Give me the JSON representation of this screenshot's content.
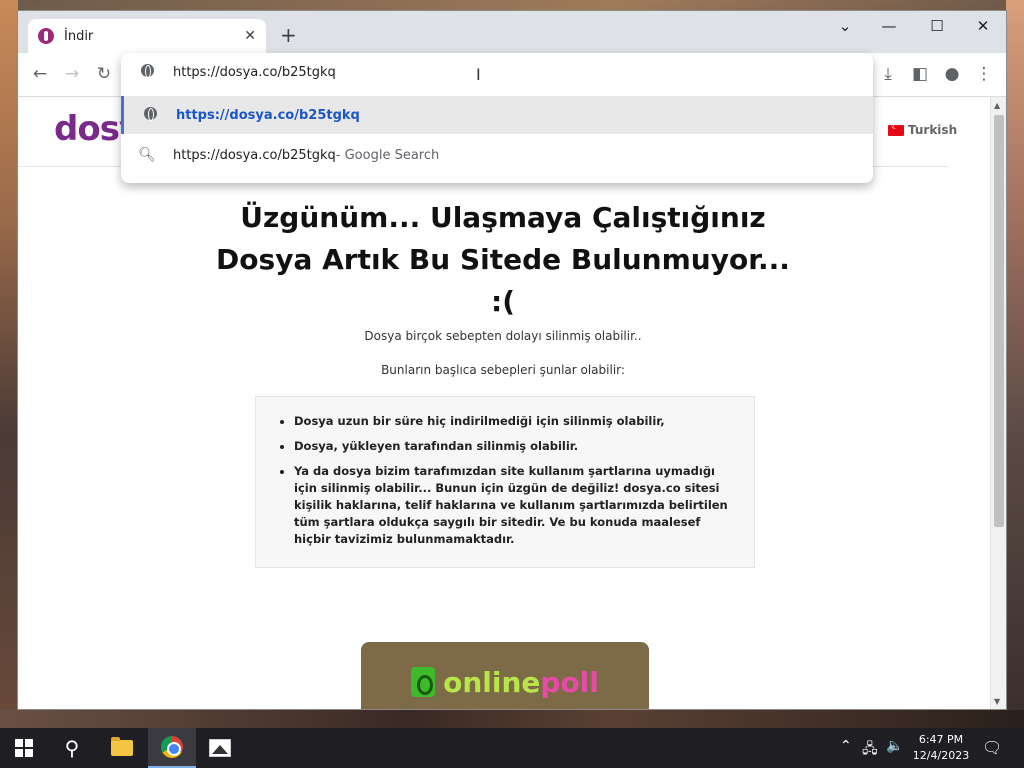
{
  "browser": {
    "tab_title": "İndir",
    "tab_close": "✕",
    "new_tab": "+",
    "controls": {
      "tab_search": "⌄",
      "minimize": "—",
      "maximize": "☐",
      "close": "✕"
    },
    "toolbar": {
      "back": "←",
      "forward": "→",
      "reload": "↻",
      "download": "⤓",
      "sidepanel": "◧",
      "profile": "●",
      "menu": "⋮"
    },
    "omnibox": {
      "input_value": "https://dosya.co/b25tgkq",
      "suggestions": [
        {
          "icon": "globe-icon",
          "text": "https://dosya.co/b25tgkq",
          "suffix": ""
        },
        {
          "icon": "search-icon",
          "text": "https://dosya.co/b25tgkq",
          "suffix": " - Google Search"
        }
      ]
    }
  },
  "site": {
    "logo": "dosya",
    "language": "Turkish",
    "heading": "Üzgünüm... Ulaşmaya Çalıştığınız Dosya Artık Bu Sitede Bulunmuyor... :(",
    "paragraph1": "Dosya birçok sebepten dolayı silinmiş olabilir..",
    "paragraph2": "Bunların başlıca sebepleri şunlar olabilir:",
    "reasons": [
      "Dosya uzun bir süre hiç indirilmediği için silinmiş olabilir,",
      "Dosya, yükleyen tarafından silinmiş olabilir.",
      "Ya da dosya bizim tarafımızdan site kullanım şartlarına uymadığı için silinmiş olabilir... Bunun için üzgün de değiliz! dosya.co sitesi kişilik haklarına, telif haklarına ve kullanım şartlarımızda belirtilen tüm şartlara oldukça saygılı bir sitedir. Ve bu konuda maalesef hiçbir tavizimiz bulunmamaktadır."
    ],
    "ad": {
      "part1": "online",
      "part2": "poll"
    }
  },
  "taskbar": {
    "time": "6:47 PM",
    "date": "12/4/2023",
    "tray": {
      "chevron": "⌃",
      "network": "🖧",
      "volume": "🔈",
      "notifications": "🗨"
    }
  },
  "colors": {
    "accent": "#1a56c8",
    "logo": "#7a2a8a",
    "taskbar": "#1f1f23"
  }
}
